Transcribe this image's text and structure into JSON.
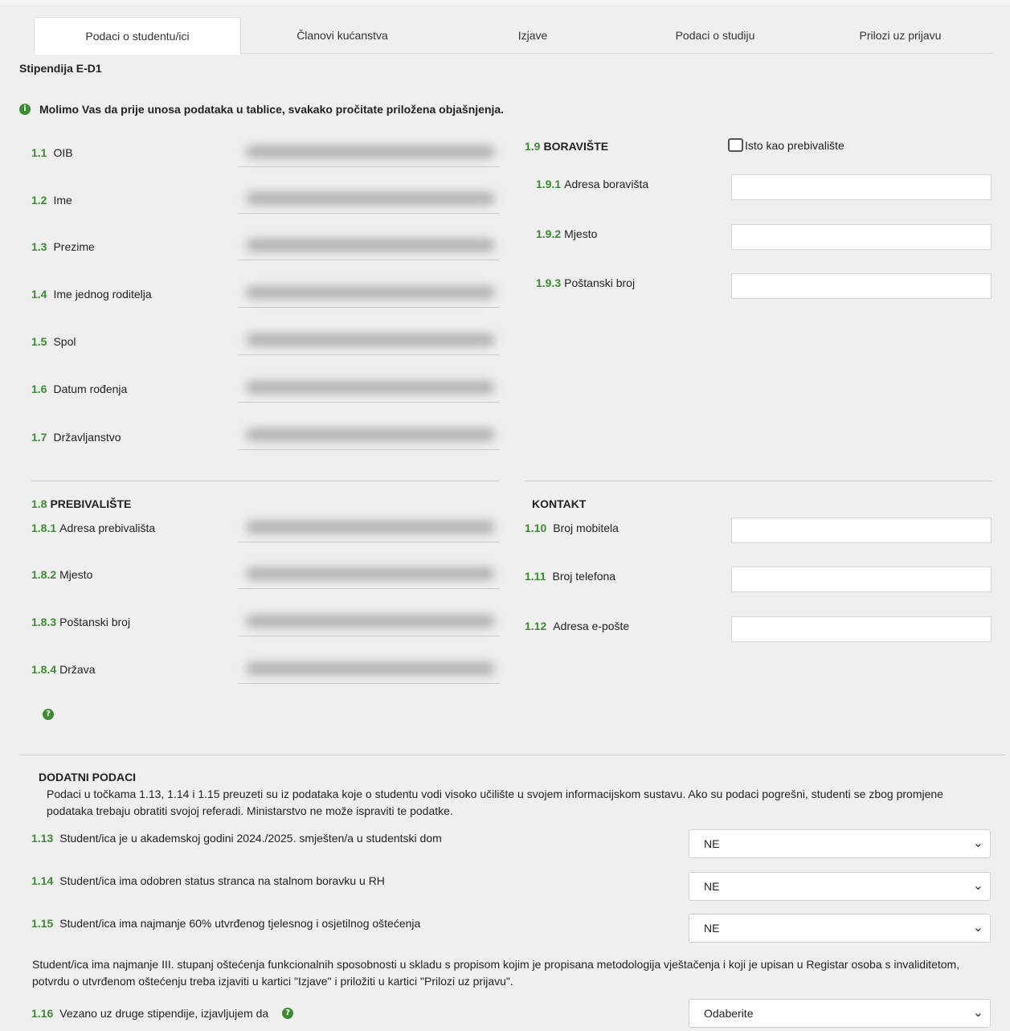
{
  "tabs": [
    "Podaci o studentu/ici",
    "Članovi kućanstva",
    "Izjave",
    "Podaci o studiju",
    "Prilozi uz prijavu"
  ],
  "form_title": "Stipendija E-D1",
  "info_text": "Molimo Vas da prije unosa podataka u tablice, svakako pročitate priložena objašnjenja.",
  "info_icon": "i",
  "personal": [
    {
      "num": "1.1",
      "label": "OIB"
    },
    {
      "num": "1.2",
      "label": "Ime"
    },
    {
      "num": "1.3",
      "label": "Prezime"
    },
    {
      "num": "1.4",
      "label": "Ime jednog roditelja"
    },
    {
      "num": "1.5",
      "label": "Spol"
    },
    {
      "num": "1.6",
      "label": "Datum rođenja"
    },
    {
      "num": "1.7",
      "label": "Državljanstvo"
    }
  ],
  "boraviste": {
    "num": "1.9",
    "title": "BORAVIŠTE",
    "checkbox_label": "Isto kao prebivalište",
    "fields": [
      {
        "num": "1.9.1",
        "label": "Adresa boravišta",
        "value": ""
      },
      {
        "num": "1.9.2",
        "label": "Mjesto",
        "value": ""
      },
      {
        "num": "1.9.3",
        "label": "Poštanski broj",
        "value": ""
      }
    ]
  },
  "prebivaliste": {
    "num": "1.8",
    "title": "PREBIVALIŠTE",
    "fields": [
      {
        "num": "1.8.1",
        "label": "Adresa prebivališta"
      },
      {
        "num": "1.8.2",
        "label": "Mjesto"
      },
      {
        "num": "1.8.3",
        "label": "Poštanski broj"
      },
      {
        "num": "1.8.4",
        "label": "Država"
      }
    ]
  },
  "kontakt": {
    "title": "KONTAKT",
    "fields": [
      {
        "num": "1.10",
        "label": "Broj mobitela",
        "value": ""
      },
      {
        "num": "1.11",
        "label": "Broj telefona",
        "value": ""
      },
      {
        "num": "1.12",
        "label": "Adresa e-pošte",
        "value": ""
      }
    ]
  },
  "help_icon": "?",
  "dodatni": {
    "title": "DODATNI PODACI",
    "paragraph": "Podaci u točkama 1.13, 1.14 i 1.15 preuzeti su iz podataka koje o studentu vodi visoko učilište u svojem informacijskom sustavu. Ako su podaci pogrešni, studenti se zbog promjene podataka trebaju obratiti svojoj referadi. Ministarstvo ne može ispraviti te podatke.",
    "questions": [
      {
        "num": "1.13",
        "label": "Student/ica je u akademskoj godini 2024./2025. smješten/a u studentski dom",
        "value": "NE"
      },
      {
        "num": "1.14",
        "label": "Student/ica ima odobren status stranca na stalnom boravku u RH",
        "value": "NE"
      },
      {
        "num": "1.15",
        "label": "Student/ica ima najmanje 60% utvrđenog tjelesnog i osjetilnog oštećenja",
        "value": "NE"
      }
    ],
    "paragraph2": "Student/ica ima najmanje III. stupanj oštećenja funkcionalnih sposobnosti u skladu s propisom kojim je propisana metodologija vještačenja i koji je upisan u Registar osoba s invaliditetom, potvrdu o utvrđenom oštećenju treba izjaviti u kartici \"Izjave\" i priložiti u kartici \"Prilozi uz prijavu\".",
    "q16": {
      "num": "1.16",
      "label": "Vezano uz druge stipendije, izjavljujem da",
      "value": "Odaberite"
    }
  },
  "chevron": "⌄"
}
